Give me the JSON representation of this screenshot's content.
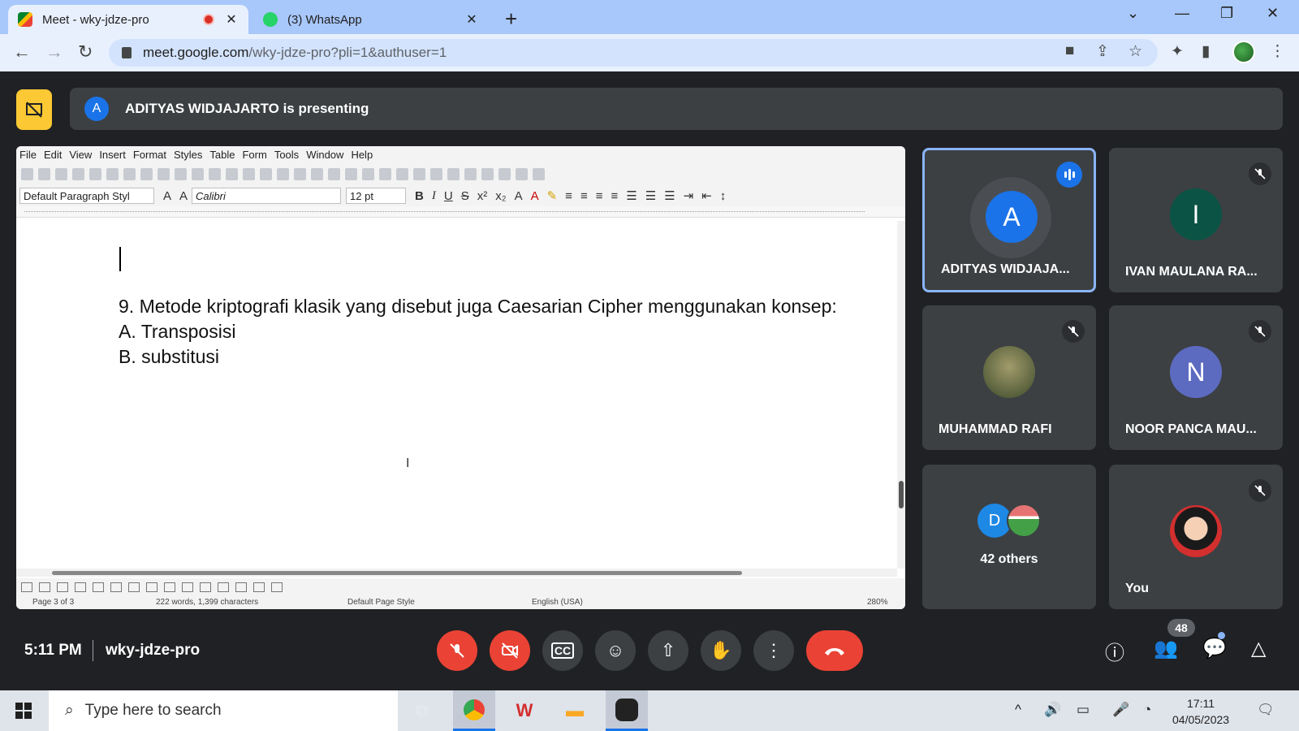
{
  "browser": {
    "tabs": [
      {
        "title": "Meet - wky-jdze-pro",
        "active": true
      },
      {
        "title": "(3) WhatsApp",
        "active": false
      }
    ],
    "url_host": "meet.google.com",
    "url_path": "/wky-jdze-pro?pli=1&authuser=1"
  },
  "meet": {
    "presenter_initial": "A",
    "presenting_text": "ADITYAS WIDJAJARTO is presenting",
    "clock": "5:11 PM",
    "meeting_code": "wky-jdze-pro",
    "people_count": "48"
  },
  "document": {
    "menu": [
      "File",
      "Edit",
      "View",
      "Insert",
      "Format",
      "Styles",
      "Table",
      "Form",
      "Tools",
      "Window",
      "Help"
    ],
    "paragraph_style": "Default Paragraph Styl",
    "font_name": "Calibri",
    "font_size": "12 pt",
    "lines": [
      "9. Metode kriptografi klasik yang disebut juga Caesarian Cipher menggunakan konsep:",
      "A. Transposisi",
      "B. substitusi"
    ],
    "status": {
      "page": "Page 3 of 3",
      "words": "222 words, 1,399 characters",
      "page_style": "Default Page Style",
      "language": "English (USA)",
      "zoom": "280%"
    }
  },
  "participants": [
    {
      "initial": "A",
      "name": "ADITYAS WIDJAJA...",
      "color": "#1a73e8",
      "speaking": true
    },
    {
      "initial": "I",
      "name": "IVAN MAULANA RA...",
      "color": "#0b5345",
      "muted": true
    },
    {
      "initial": "",
      "name": "MUHAMMAD RAFI",
      "color": "#5d6b45",
      "muted": true
    },
    {
      "initial": "N",
      "name": "NOOR PANCA MAU...",
      "color": "#5c6bc0",
      "muted": true
    },
    {
      "initial": "D",
      "name": "42 others",
      "color": "#1e88e5"
    },
    {
      "initial": "",
      "name": "You",
      "color": "#d32f2f",
      "muted": true
    }
  ],
  "taskbar": {
    "search_placeholder": "Type here to search",
    "time": "17:11",
    "date": "04/05/2023"
  }
}
